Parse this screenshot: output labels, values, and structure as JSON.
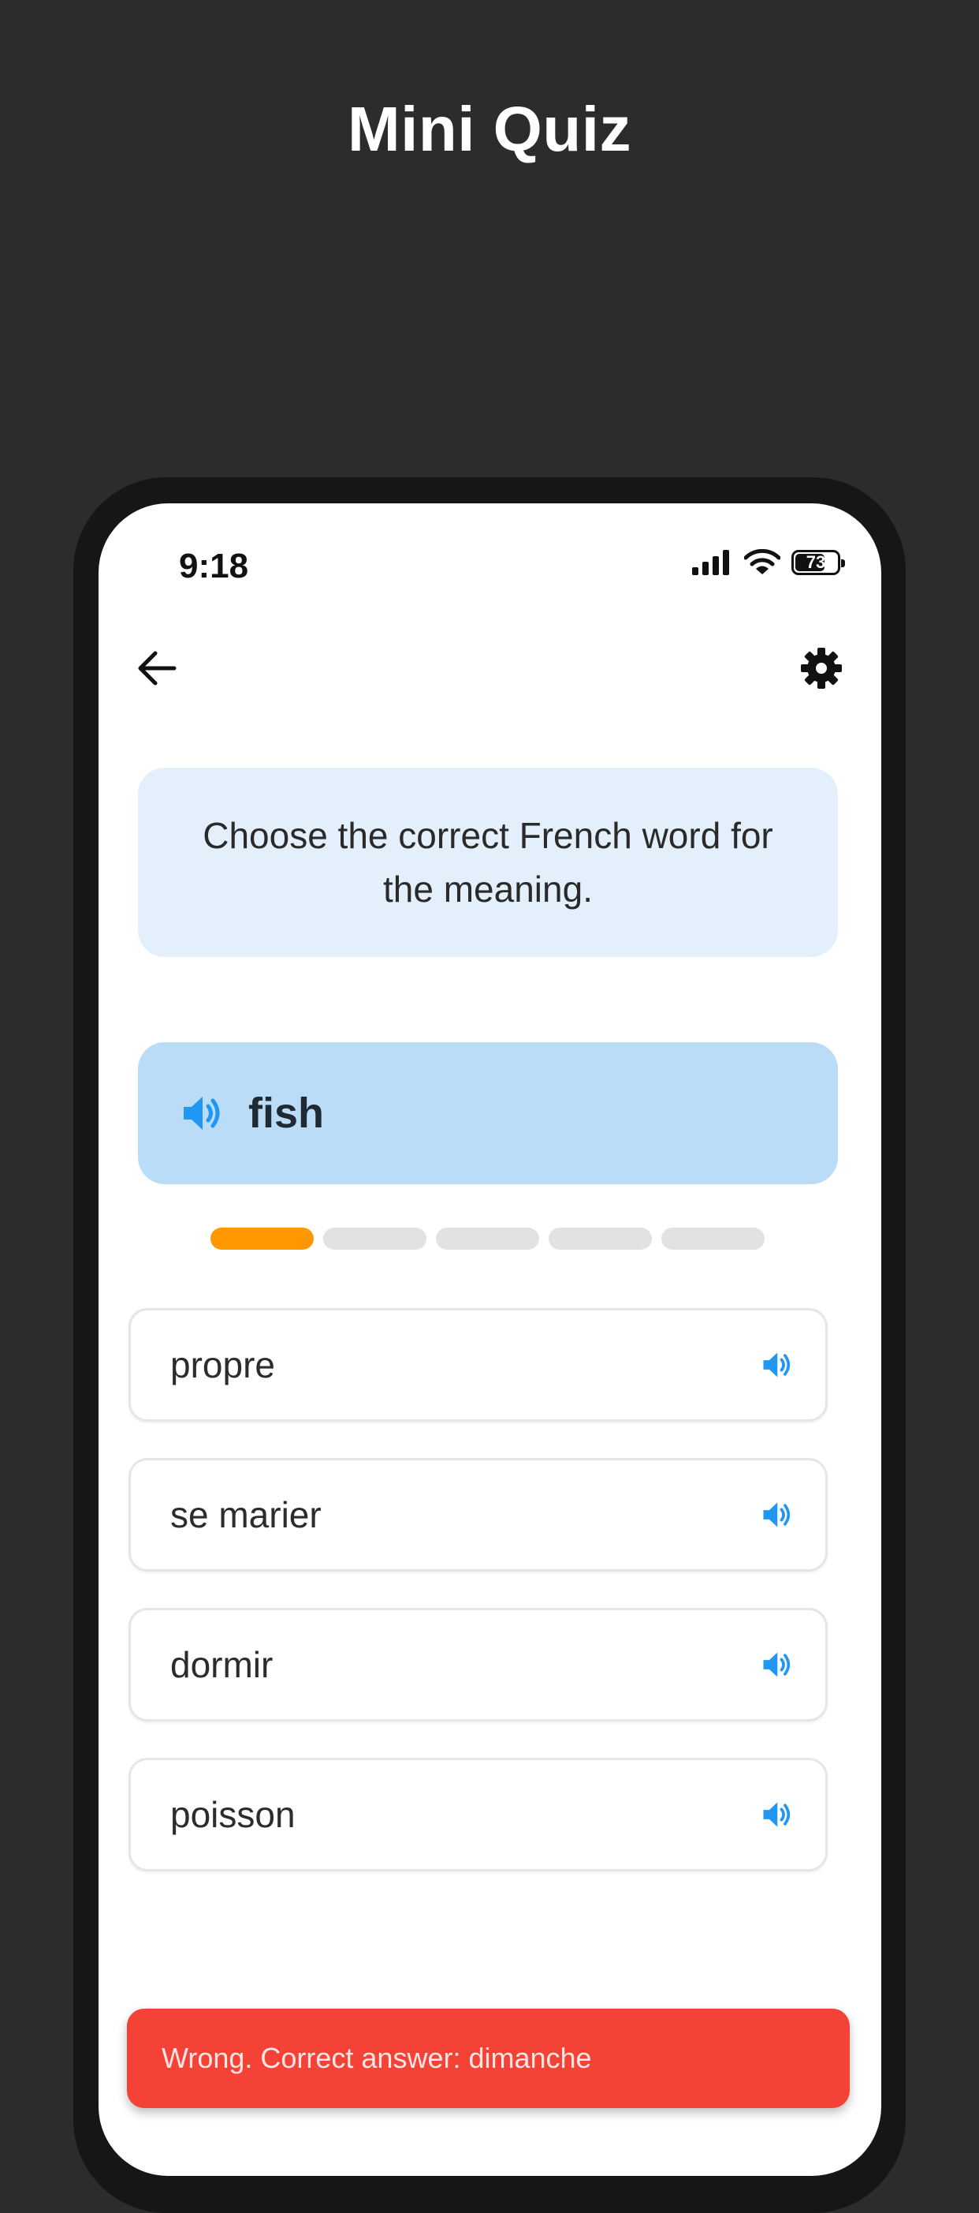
{
  "promo": {
    "title": "Mini Quiz"
  },
  "status_bar": {
    "time": "9:18",
    "battery_level": "73",
    "battery_fraction": 0.73
  },
  "icons": {
    "back": "arrow-left-icon",
    "settings": "gear-icon",
    "speaker": "speaker-icon",
    "signal": "cellular-signal-icon",
    "wifi": "wifi-icon",
    "battery": "battery-icon"
  },
  "colors": {
    "accent": "#2196f3",
    "progress_active": "#ff9800",
    "error": "#f44336",
    "instruction_bg": "#e3f0fb",
    "prompt_bg": "#bbdcf7"
  },
  "quiz": {
    "instruction": "Choose the correct French word for the meaning.",
    "prompt_word": "fish",
    "progress": {
      "total": 5,
      "current": 1
    },
    "options": [
      {
        "label": "propre"
      },
      {
        "label": "se marier"
      },
      {
        "label": "dormir"
      },
      {
        "label": "poisson"
      }
    ],
    "feedback": "Wrong. Correct answer: dimanche"
  }
}
